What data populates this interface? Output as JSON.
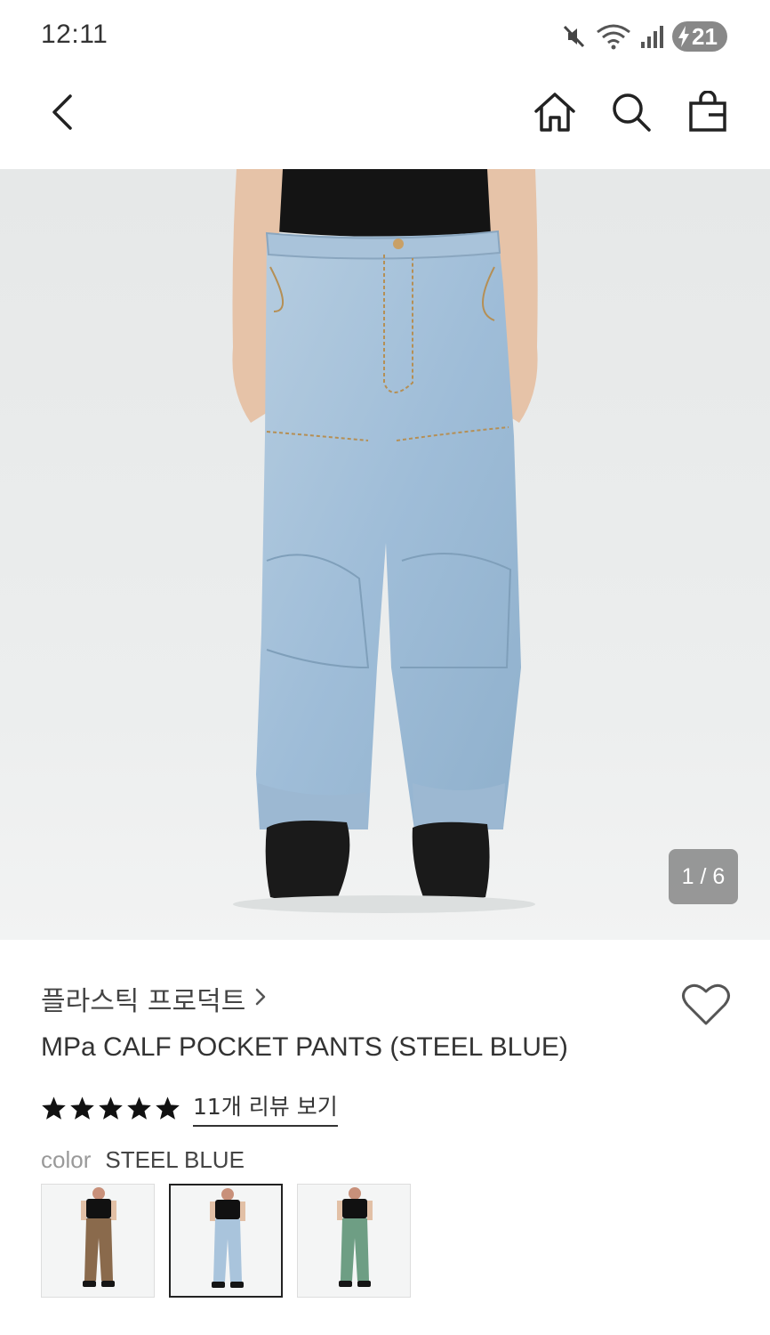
{
  "status_bar": {
    "time": "12:11",
    "battery_level": "21",
    "icons": [
      "mute-icon",
      "wifi-icon",
      "signal-icon",
      "battery-charging-icon"
    ]
  },
  "header": {
    "back_icon": "chevron-left-icon",
    "action_icons": [
      "home-icon",
      "search-icon",
      "shopping-bag-icon"
    ]
  },
  "gallery": {
    "counter": "1 / 6",
    "current": 1,
    "total": 6
  },
  "product": {
    "brand": "플라스틱 프로덕트",
    "title": "MPa CALF POCKET PANTS (STEEL BLUE)",
    "rating": 5,
    "rating_max": 5,
    "review_link": "11개 리뷰 보기",
    "color_label": "color",
    "color_value": "STEEL BLUE",
    "swatches": [
      {
        "variant_color": "#8a6a4c",
        "selected": false
      },
      {
        "variant_color": "#a9c4dc",
        "selected": true
      },
      {
        "variant_color": "#6e9e84",
        "selected": false
      }
    ]
  },
  "colors": {
    "text_primary": "#333333",
    "text_muted": "#999999",
    "image_background": "#e8eaea",
    "denim": "#a9c4dc"
  }
}
